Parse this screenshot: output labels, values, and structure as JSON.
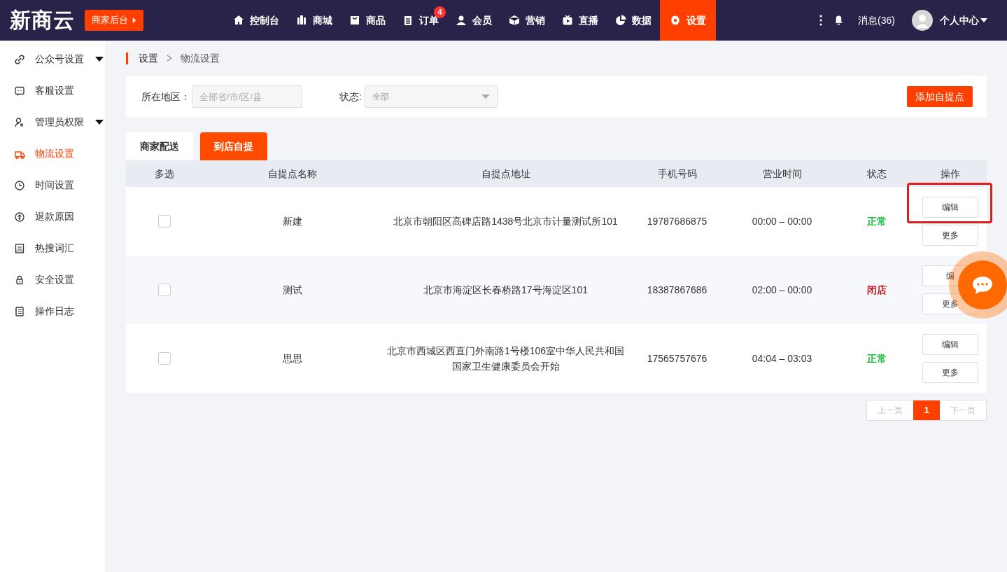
{
  "brand": {
    "logo": "新商云",
    "backend_button": "商家后台"
  },
  "nav": [
    {
      "label": "控制台",
      "selected": false
    },
    {
      "label": "商城",
      "selected": false
    },
    {
      "label": "商品",
      "selected": false
    },
    {
      "label": "订单",
      "selected": false,
      "badge": "4"
    },
    {
      "label": "会员",
      "selected": false
    },
    {
      "label": "营销",
      "selected": false
    },
    {
      "label": "直播",
      "selected": false
    },
    {
      "label": "数据",
      "selected": false
    },
    {
      "label": "设置",
      "selected": true
    }
  ],
  "header_right": {
    "messages": "消息(36)",
    "user": "个人中心"
  },
  "sidebar": {
    "items": [
      {
        "label": "公众号设置",
        "selected": false,
        "expandable": true
      },
      {
        "label": "客服设置",
        "selected": false,
        "expandable": false
      },
      {
        "label": "管理员权限",
        "selected": false,
        "expandable": true
      },
      {
        "label": "物流设置",
        "selected": true,
        "expandable": false
      },
      {
        "label": "时间设置",
        "selected": false,
        "expandable": false
      },
      {
        "label": "退款原因",
        "selected": false,
        "expandable": false
      },
      {
        "label": "热搜词汇",
        "selected": false,
        "expandable": false
      },
      {
        "label": "安全设置",
        "selected": false,
        "expandable": false
      },
      {
        "label": "操作日志",
        "selected": false,
        "expandable": false
      }
    ]
  },
  "breadcrumb": [
    "设置",
    "物流设置"
  ],
  "filters": {
    "region_label": "所在地区：",
    "region_placeholder": "全部省/市/区/县",
    "status_label": "状态:",
    "status_value": "全部",
    "add_button": "添加自提点"
  },
  "tabs": [
    {
      "label": "商家配送",
      "selected": false
    },
    {
      "label": "到店自提",
      "selected": true
    }
  ],
  "table": {
    "columns": [
      "多选",
      "自提点名称",
      "自提点地址",
      "手机号码",
      "营业时间",
      "状态",
      "操作"
    ],
    "rows": [
      {
        "checked": false,
        "name": "新建",
        "address": "北京市朝阳区高碑店路1438号北京市计量测试所101",
        "phone": "19787686875",
        "hours": "00:00 – 00:00",
        "status": "正常",
        "color": "#19be3b",
        "actions": [
          "编辑",
          "更多"
        ],
        "highlighted": true
      },
      {
        "checked": false,
        "name": "测试",
        "address": "北京市海淀区长春桥路17号海淀区101",
        "phone": "18387867686",
        "hours": "02:00 – 00:00",
        "status": "闭店",
        "color": "#c4161c",
        "actions": [
          "编",
          "更多"
        ],
        "highlighted": false
      },
      {
        "checked": false,
        "name": "思思",
        "address": "北京市西城区西直门外南路1号楼106室中华人民共和国国家卫生健康委员会开始",
        "phone": "17565757676",
        "hours": "04:04 – 03:03",
        "status": "正常",
        "color": "#19be3b",
        "actions": [
          "编辑",
          "更多"
        ],
        "highlighted": false
      }
    ]
  },
  "pagination": {
    "prev": "上一页",
    "pages": [
      {
        "label": "1",
        "selected": true
      }
    ],
    "next": "下一页"
  },
  "chat_button": {
    "visible": true
  }
}
